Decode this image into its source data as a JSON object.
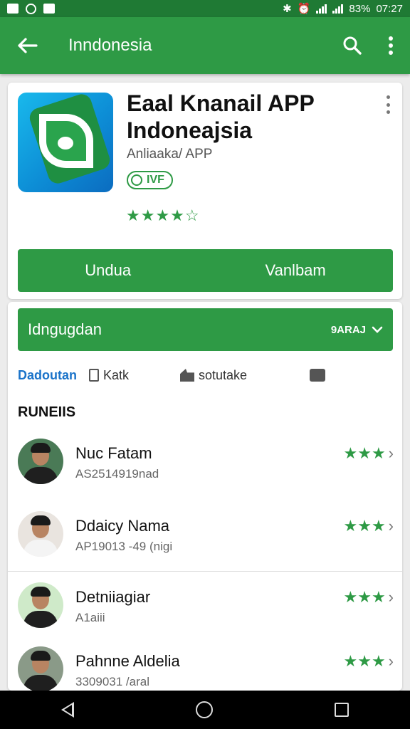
{
  "status_bar": {
    "battery": "83%",
    "time": "07:27"
  },
  "app_bar": {
    "title": "Inndonesia"
  },
  "app": {
    "title_line1": "Eaal Knanail APP",
    "title_line2": "Indoneajsia",
    "developer": "Anliaaka/ APP",
    "badge": "IVF",
    "rating_stars": "★★★★☆",
    "install_left": "Undua",
    "install_right": "Vanlbam"
  },
  "section": {
    "label": "Idngugdan",
    "right_label": "9ARAJ"
  },
  "filters": [
    "Dadoutan",
    "Katk",
    "sotutake"
  ],
  "reviews_title": "RUNEIIS",
  "reviews": [
    {
      "name": "Nuc Fatam",
      "meta": "AS2514919nad",
      "stars": "★★★"
    },
    {
      "name": "Ddaicy Nama",
      "meta": "AP19013 -49 (nigi",
      "stars": "★★★"
    },
    {
      "name": "Detniiagiar",
      "meta": "A1aiii",
      "stars": "★★★"
    },
    {
      "name": "Pahnne Aldelia",
      "meta": "3309031 /aral",
      "stars": "★★★"
    }
  ],
  "colors": {
    "primary": "#2e9a45",
    "status_bar": "#1f7a34",
    "link_blue": "#1a73c9"
  },
  "icons": [
    "back-arrow-icon",
    "search-icon",
    "overflow-menu-icon",
    "chevron-down-icon",
    "chevron-right-icon",
    "thumbs-up-icon",
    "phone-icon",
    "share-icon"
  ]
}
